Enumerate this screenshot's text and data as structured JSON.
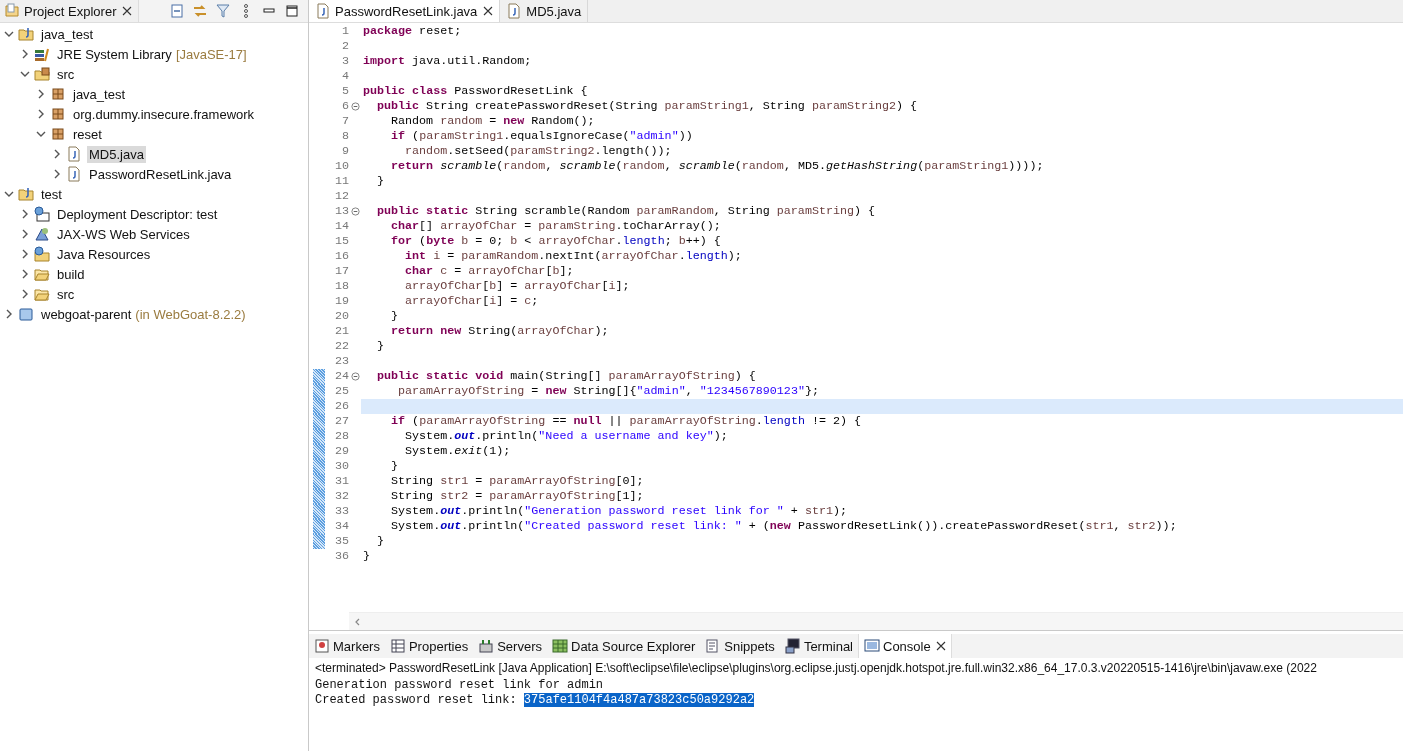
{
  "explorer": {
    "title": "Project Explorer",
    "items": [
      {
        "label": "java_test",
        "kind": "project",
        "expanded": true,
        "selected": false,
        "children": [
          {
            "label": "JRE System Library",
            "decoration": "[JavaSE-17]",
            "kind": "library",
            "expanded": false,
            "selected": false
          },
          {
            "label": "src",
            "kind": "srcfolder",
            "expanded": true,
            "selected": false,
            "children": [
              {
                "label": "java_test",
                "kind": "package",
                "expanded": false,
                "selected": false
              },
              {
                "label": "org.dummy.insecure.framework",
                "kind": "package",
                "expanded": false,
                "selected": false
              },
              {
                "label": "reset",
                "kind": "package",
                "expanded": true,
                "selected": false,
                "children": [
                  {
                    "label": "MD5.java",
                    "kind": "file",
                    "expanded": false,
                    "selected": true
                  },
                  {
                    "label": "PasswordResetLink.java",
                    "kind": "file",
                    "expanded": false,
                    "selected": false
                  }
                ]
              }
            ]
          }
        ]
      },
      {
        "label": "test",
        "kind": "project",
        "expanded": true,
        "selected": false,
        "children": [
          {
            "label": "Deployment Descriptor: test",
            "kind": "descriptor",
            "expanded": false,
            "selected": false
          },
          {
            "label": "JAX-WS Web Services",
            "kind": "webservices",
            "expanded": false,
            "selected": false
          },
          {
            "label": "Java Resources",
            "kind": "resources",
            "expanded": false,
            "selected": false
          },
          {
            "label": "build",
            "kind": "folder",
            "expanded": false,
            "selected": false
          },
          {
            "label": "src",
            "kind": "folder",
            "expanded": false,
            "selected": false
          }
        ]
      },
      {
        "label": "webgoat-parent",
        "decoration": "(in WebGoat-8.2.2)",
        "kind": "workingset",
        "expanded": false,
        "selected": false
      }
    ]
  },
  "editor": {
    "tabs": [
      {
        "label": "PasswordResetLink.java",
        "selected": true
      },
      {
        "label": "MD5.java",
        "selected": false
      }
    ],
    "lines": [
      {
        "number": "1",
        "fold": false,
        "changed": false,
        "current": false,
        "tokens": [
          {
            "kind": "kw",
            "text": "package"
          },
          {
            "kind": "p",
            "text": " reset;"
          }
        ]
      },
      {
        "number": "2",
        "fold": false,
        "changed": false,
        "current": false
      },
      {
        "number": "3",
        "fold": false,
        "changed": false,
        "current": false,
        "tokens": [
          {
            "kind": "kw",
            "text": "import"
          },
          {
            "kind": "p",
            "text": " java.util.Random;"
          }
        ]
      },
      {
        "number": "4",
        "fold": false,
        "changed": false,
        "current": false
      },
      {
        "number": "5",
        "fold": false,
        "changed": false,
        "current": false,
        "tokens": [
          {
            "kind": "kw",
            "text": "public"
          },
          {
            "kind": "kw",
            "text": " class"
          },
          {
            "kind": "p",
            "text": " PasswordResetLink {"
          }
        ]
      },
      {
        "number": "6",
        "fold": true,
        "changed": false,
        "current": false,
        "tokens": [
          {
            "kind": "kw",
            "text": "  public"
          },
          {
            "kind": "p",
            "text": " String createPasswordReset(String "
          },
          {
            "kind": "var",
            "text": "paramString1"
          },
          {
            "kind": "p",
            "text": ", String "
          },
          {
            "kind": "var",
            "text": "paramString2"
          },
          {
            "kind": "p",
            "text": ") {"
          }
        ]
      },
      {
        "number": "7",
        "fold": false,
        "changed": false,
        "current": false,
        "tokens": [
          {
            "kind": "p",
            "text": "    Random "
          },
          {
            "kind": "var",
            "text": "random"
          },
          {
            "kind": "p",
            "text": " = "
          },
          {
            "kind": "kw",
            "text": "new"
          },
          {
            "kind": "p",
            "text": " Random();"
          }
        ]
      },
      {
        "number": "8",
        "fold": false,
        "changed": false,
        "current": false,
        "tokens": [
          {
            "kind": "kw",
            "text": "    if"
          },
          {
            "kind": "p",
            "text": " ("
          },
          {
            "kind": "var",
            "text": "paramString1"
          },
          {
            "kind": "p",
            "text": ".equalsIgnoreCase("
          },
          {
            "kind": "str",
            "text": "\"admin\""
          },
          {
            "kind": "p",
            "text": "))"
          }
        ]
      },
      {
        "number": "9",
        "fold": false,
        "changed": false,
        "current": false,
        "tokens": [
          {
            "kind": "var",
            "text": "      random"
          },
          {
            "kind": "p",
            "text": ".setSeed("
          },
          {
            "kind": "var",
            "text": "paramString2"
          },
          {
            "kind": "p",
            "text": ".length());"
          }
        ]
      },
      {
        "number": "10",
        "fold": false,
        "changed": false,
        "current": false,
        "tokens": [
          {
            "kind": "kw",
            "text": "    return"
          },
          {
            "kind": "it",
            "text": " scramble"
          },
          {
            "kind": "p",
            "text": "("
          },
          {
            "kind": "var",
            "text": "random"
          },
          {
            "kind": "p",
            "text": ", "
          },
          {
            "kind": "it",
            "text": "scramble"
          },
          {
            "kind": "p",
            "text": "("
          },
          {
            "kind": "var",
            "text": "random"
          },
          {
            "kind": "p",
            "text": ", "
          },
          {
            "kind": "it",
            "text": "scramble"
          },
          {
            "kind": "p",
            "text": "("
          },
          {
            "kind": "var",
            "text": "random"
          },
          {
            "kind": "p",
            "text": ", MD5."
          },
          {
            "kind": "it",
            "text": "getHashString"
          },
          {
            "kind": "p",
            "text": "("
          },
          {
            "kind": "var",
            "text": "paramString1"
          },
          {
            "kind": "p",
            "text": "))));"
          }
        ]
      },
      {
        "number": "11",
        "fold": false,
        "changed": false,
        "current": false,
        "tokens": [
          {
            "kind": "p",
            "text": "  }"
          }
        ]
      },
      {
        "number": "12",
        "fold": false,
        "changed": false,
        "current": false
      },
      {
        "number": "13",
        "fold": true,
        "changed": false,
        "current": false,
        "tokens": [
          {
            "kind": "kw",
            "text": "  public"
          },
          {
            "kind": "kw",
            "text": " static"
          },
          {
            "kind": "p",
            "text": " String scramble(Random "
          },
          {
            "kind": "var",
            "text": "paramRandom"
          },
          {
            "kind": "p",
            "text": ", String "
          },
          {
            "kind": "var",
            "text": "paramString"
          },
          {
            "kind": "p",
            "text": ") {"
          }
        ]
      },
      {
        "number": "14",
        "fold": false,
        "changed": false,
        "current": false,
        "tokens": [
          {
            "kind": "kw",
            "text": "    char"
          },
          {
            "kind": "p",
            "text": "[] "
          },
          {
            "kind": "var",
            "text": "arrayOfChar"
          },
          {
            "kind": "p",
            "text": " = "
          },
          {
            "kind": "var",
            "text": "paramString"
          },
          {
            "kind": "p",
            "text": ".toCharArray();"
          }
        ]
      },
      {
        "number": "15",
        "fold": false,
        "changed": false,
        "current": false,
        "tokens": [
          {
            "kind": "kw",
            "text": "    for"
          },
          {
            "kind": "p",
            "text": " ("
          },
          {
            "kind": "kw",
            "text": "byte"
          },
          {
            "kind": "var",
            "text": " b"
          },
          {
            "kind": "p",
            "text": " = 0; "
          },
          {
            "kind": "var",
            "text": "b"
          },
          {
            "kind": "p",
            "text": " < "
          },
          {
            "kind": "var",
            "text": "arrayOfChar"
          },
          {
            "kind": "p",
            "text": "."
          },
          {
            "kind": "fld",
            "text": "length"
          },
          {
            "kind": "p",
            "text": "; "
          },
          {
            "kind": "var",
            "text": "b"
          },
          {
            "kind": "p",
            "text": "++) {"
          }
        ]
      },
      {
        "number": "16",
        "fold": false,
        "changed": false,
        "current": false,
        "tokens": [
          {
            "kind": "kw",
            "text": "      int"
          },
          {
            "kind": "var",
            "text": " i"
          },
          {
            "kind": "p",
            "text": " = "
          },
          {
            "kind": "var",
            "text": "paramRandom"
          },
          {
            "kind": "p",
            "text": ".nextInt("
          },
          {
            "kind": "var",
            "text": "arrayOfChar"
          },
          {
            "kind": "p",
            "text": "."
          },
          {
            "kind": "fld",
            "text": "length"
          },
          {
            "kind": "p",
            "text": ");"
          }
        ]
      },
      {
        "number": "17",
        "fold": false,
        "changed": false,
        "current": false,
        "tokens": [
          {
            "kind": "kw",
            "text": "      char"
          },
          {
            "kind": "var",
            "text": " c"
          },
          {
            "kind": "p",
            "text": " = "
          },
          {
            "kind": "var",
            "text": "arrayOfChar"
          },
          {
            "kind": "p",
            "text": "["
          },
          {
            "kind": "var",
            "text": "b"
          },
          {
            "kind": "p",
            "text": "];"
          }
        ]
      },
      {
        "number": "18",
        "fold": false,
        "changed": false,
        "current": false,
        "tokens": [
          {
            "kind": "var",
            "text": "      arrayOfChar"
          },
          {
            "kind": "p",
            "text": "["
          },
          {
            "kind": "var",
            "text": "b"
          },
          {
            "kind": "p",
            "text": "] = "
          },
          {
            "kind": "var",
            "text": "arrayOfChar"
          },
          {
            "kind": "p",
            "text": "["
          },
          {
            "kind": "var",
            "text": "i"
          },
          {
            "kind": "p",
            "text": "];"
          }
        ]
      },
      {
        "number": "19",
        "fold": false,
        "changed": false,
        "current": false,
        "tokens": [
          {
            "kind": "var",
            "text": "      arrayOfChar"
          },
          {
            "kind": "p",
            "text": "["
          },
          {
            "kind": "var",
            "text": "i"
          },
          {
            "kind": "p",
            "text": "] = "
          },
          {
            "kind": "var",
            "text": "c"
          },
          {
            "kind": "p",
            "text": ";"
          }
        ]
      },
      {
        "number": "20",
        "fold": false,
        "changed": false,
        "current": false,
        "tokens": [
          {
            "kind": "p",
            "text": "    }"
          }
        ]
      },
      {
        "number": "21",
        "fold": false,
        "changed": false,
        "current": false,
        "tokens": [
          {
            "kind": "kw",
            "text": "    return"
          },
          {
            "kind": "kw",
            "text": " new"
          },
          {
            "kind": "p",
            "text": " String("
          },
          {
            "kind": "var",
            "text": "arrayOfChar"
          },
          {
            "kind": "p",
            "text": ");"
          }
        ]
      },
      {
        "number": "22",
        "fold": false,
        "changed": false,
        "current": false,
        "tokens": [
          {
            "kind": "p",
            "text": "  }"
          }
        ]
      },
      {
        "number": "23",
        "fold": false,
        "changed": false,
        "current": false
      },
      {
        "number": "24",
        "fold": true,
        "changed": true,
        "current": false,
        "tokens": [
          {
            "kind": "kw",
            "text": "  public"
          },
          {
            "kind": "kw",
            "text": " static"
          },
          {
            "kind": "kw",
            "text": " void"
          },
          {
            "kind": "p",
            "text": " main(String[] "
          },
          {
            "kind": "var",
            "text": "paramArrayOfString"
          },
          {
            "kind": "p",
            "text": ") {"
          }
        ]
      },
      {
        "number": "25",
        "fold": false,
        "changed": true,
        "current": false,
        "tokens": [
          {
            "kind": "var",
            "text": "     paramArrayOfString"
          },
          {
            "kind": "p",
            "text": " = "
          },
          {
            "kind": "kw",
            "text": "new"
          },
          {
            "kind": "p",
            "text": " String[]{"
          },
          {
            "kind": "str",
            "text": "\"admin\""
          },
          {
            "kind": "p",
            "text": ", "
          },
          {
            "kind": "str",
            "text": "\"1234567890123\""
          },
          {
            "kind": "p",
            "text": "};"
          }
        ]
      },
      {
        "number": "26",
        "fold": false,
        "changed": true,
        "current": true
      },
      {
        "number": "27",
        "fold": false,
        "changed": true,
        "current": false,
        "tokens": [
          {
            "kind": "kw",
            "text": "    if"
          },
          {
            "kind": "p",
            "text": " ("
          },
          {
            "kind": "var",
            "text": "paramArrayOfString"
          },
          {
            "kind": "p",
            "text": " == "
          },
          {
            "kind": "kw",
            "text": "null"
          },
          {
            "kind": "p",
            "text": " || "
          },
          {
            "kind": "var",
            "text": "paramArrayOfString"
          },
          {
            "kind": "p",
            "text": "."
          },
          {
            "kind": "fld",
            "text": "length"
          },
          {
            "kind": "p",
            "text": " != 2) {"
          }
        ]
      },
      {
        "number": "28",
        "fold": false,
        "changed": true,
        "current": false,
        "tokens": [
          {
            "kind": "p",
            "text": "      System."
          },
          {
            "kind": "sfld",
            "text": "out"
          },
          {
            "kind": "p",
            "text": ".println("
          },
          {
            "kind": "str",
            "text": "\"Need a username and key\""
          },
          {
            "kind": "p",
            "text": ");"
          }
        ]
      },
      {
        "number": "29",
        "fold": false,
        "changed": true,
        "current": false,
        "tokens": [
          {
            "kind": "p",
            "text": "      System."
          },
          {
            "kind": "it",
            "text": "exit"
          },
          {
            "kind": "p",
            "text": "(1);"
          }
        ]
      },
      {
        "number": "30",
        "fold": false,
        "changed": true,
        "current": false,
        "tokens": [
          {
            "kind": "p",
            "text": "    }"
          }
        ]
      },
      {
        "number": "31",
        "fold": false,
        "changed": true,
        "current": false,
        "tokens": [
          {
            "kind": "p",
            "text": "    String "
          },
          {
            "kind": "var",
            "text": "str1"
          },
          {
            "kind": "p",
            "text": " = "
          },
          {
            "kind": "var",
            "text": "paramArrayOfString"
          },
          {
            "kind": "p",
            "text": "[0];"
          }
        ]
      },
      {
        "number": "32",
        "fold": false,
        "changed": true,
        "current": false,
        "tokens": [
          {
            "kind": "p",
            "text": "    String "
          },
          {
            "kind": "var",
            "text": "str2"
          },
          {
            "kind": "p",
            "text": " = "
          },
          {
            "kind": "var",
            "text": "paramArrayOfString"
          },
          {
            "kind": "p",
            "text": "[1];"
          }
        ]
      },
      {
        "number": "33",
        "fold": false,
        "changed": true,
        "current": false,
        "tokens": [
          {
            "kind": "p",
            "text": "    System."
          },
          {
            "kind": "sfld",
            "text": "out"
          },
          {
            "kind": "p",
            "text": ".println("
          },
          {
            "kind": "str",
            "text": "\"Generation password reset link for \""
          },
          {
            "kind": "p",
            "text": " + "
          },
          {
            "kind": "var",
            "text": "str1"
          },
          {
            "kind": "p",
            "text": ");"
          }
        ]
      },
      {
        "number": "34",
        "fold": false,
        "changed": true,
        "current": false,
        "tokens": [
          {
            "kind": "p",
            "text": "    System."
          },
          {
            "kind": "sfld",
            "text": "out"
          },
          {
            "kind": "p",
            "text": ".println("
          },
          {
            "kind": "str",
            "text": "\"Created password reset link: \""
          },
          {
            "kind": "p",
            "text": " + ("
          },
          {
            "kind": "kw",
            "text": "new"
          },
          {
            "kind": "p",
            "text": " PasswordResetLink()).createPasswordReset("
          },
          {
            "kind": "var",
            "text": "str1"
          },
          {
            "kind": "p",
            "text": ", "
          },
          {
            "kind": "var",
            "text": "str2"
          },
          {
            "kind": "p",
            "text": "));"
          }
        ]
      },
      {
        "number": "35",
        "fold": false,
        "changed": true,
        "current": false,
        "tokens": [
          {
            "kind": "p",
            "text": "  }"
          }
        ]
      },
      {
        "number": "36",
        "fold": false,
        "changed": false,
        "current": false,
        "tokens": [
          {
            "kind": "p",
            "text": "}"
          }
        ]
      }
    ]
  },
  "bottom_panel": {
    "tabs": [
      {
        "label": "Markers",
        "kind": "markers",
        "selected": false
      },
      {
        "label": "Properties",
        "kind": "properties",
        "selected": false
      },
      {
        "label": "Servers",
        "kind": "servers",
        "selected": false
      },
      {
        "label": "Data Source Explorer",
        "kind": "datasource",
        "selected": false
      },
      {
        "label": "Snippets",
        "kind": "snippets",
        "selected": false
      },
      {
        "label": "Terminal",
        "kind": "terminal",
        "selected": false
      },
      {
        "label": "Console",
        "kind": "console",
        "selected": true
      }
    ],
    "console": {
      "header": "<terminated> PasswordResetLink [Java Application] E:\\soft\\eclipse\\file\\eclipse\\plugins\\org.eclipse.justj.openjdk.hotspot.jre.full.win32.x86_64_17.0.3.v20220515-1416\\jre\\bin\\javaw.exe  (2022",
      "output": [
        {
          "text": "Generation password reset link for admin"
        },
        {
          "text": "Created password reset link: ",
          "selected_text": "375afe1104f4a487a73823c50a9292a2"
        }
      ]
    }
  }
}
